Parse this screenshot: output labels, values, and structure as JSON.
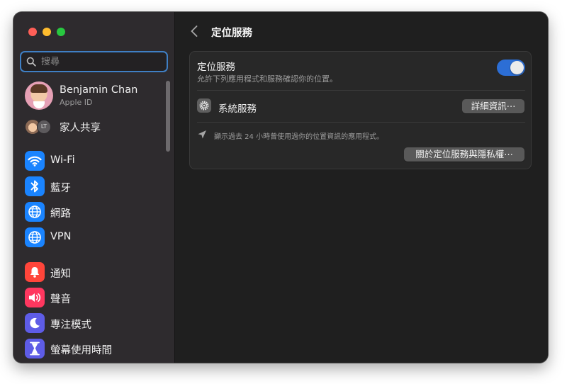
{
  "window": {
    "traffic_lights": {
      "close": "#ff5f57",
      "minimize": "#febc2e",
      "zoom": "#28c840"
    }
  },
  "sidebar": {
    "search": {
      "placeholder": "搜尋",
      "value": ""
    },
    "profile": {
      "name": "Benjamin Chan",
      "subtitle": "Apple ID"
    },
    "family": {
      "initials": "LT",
      "label": "家人共享"
    },
    "items": [
      {
        "label": "Wi-Fi",
        "icon": "wifi-icon",
        "color": "#1a84ff"
      },
      {
        "label": "藍牙",
        "icon": "bluetooth-icon",
        "color": "#1a84ff"
      },
      {
        "label": "網路",
        "icon": "globe-icon",
        "color": "#1a84ff"
      },
      {
        "label": "VPN",
        "icon": "globe-icon",
        "color": "#1a84ff"
      },
      {
        "label": "通知",
        "icon": "bell-icon",
        "color": "#ff453a"
      },
      {
        "label": "聲音",
        "icon": "speaker-icon",
        "color": "#ff375f"
      },
      {
        "label": "專注模式",
        "icon": "moon-icon",
        "color": "#5e5ce6"
      },
      {
        "label": "螢幕使用時間",
        "icon": "hourglass-icon",
        "color": "#5e5ce6"
      }
    ]
  },
  "content": {
    "back_icon": "chevron-left-icon",
    "title": "定位服務",
    "location_services": {
      "label": "定位服務",
      "description": "允許下列應用程式和服務確認你的位置。",
      "enabled": true,
      "toggle_color": "#2c6ed5"
    },
    "system_services": {
      "label": "系統服務",
      "icon": "gear-icon",
      "button": "詳細資訊⋯"
    },
    "recent_usage_note": "顯示過去 24 小時曾使用過你的位置資訊的應用程式。",
    "recent_icon": "location-arrow-icon",
    "about_button": "關於定位服務與隱私權⋯"
  }
}
